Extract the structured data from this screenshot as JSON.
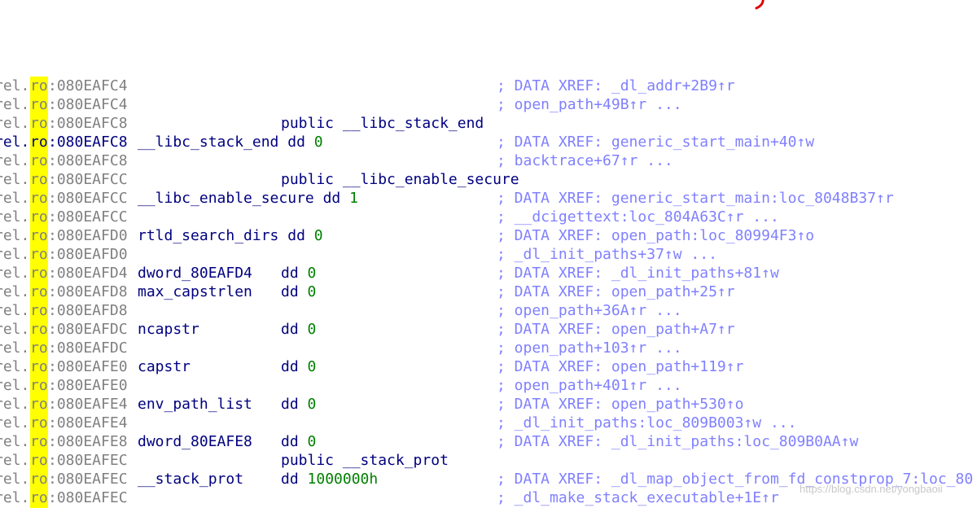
{
  "colors": {
    "address": "#808080",
    "address_current": "#000080",
    "name": "#000080",
    "number": "#008000",
    "comment": "#8080ff",
    "highlight": "#ffff00",
    "mark": "#e00000"
  },
  "segment": {
    "prefix": "rel.",
    "highlight": "ro"
  },
  "lines": [
    {
      "addr": ":080EAFC4",
      "name": "",
      "instr": "",
      "value": "",
      "comment": "; DATA XREF: _dl_addr+2B9↑r"
    },
    {
      "addr": ":080EAFC4",
      "name": "",
      "instr": "",
      "value": "",
      "comment": "; open_path+49B↑r ..."
    },
    {
      "addr": ":080EAFC8",
      "name": "",
      "instr": "public __libc_stack_end",
      "value": "",
      "comment": ""
    },
    {
      "addr": ":080EAFC8",
      "name": "__libc_stack_end dd ",
      "instr": "",
      "value": "0",
      "comment": "; DATA XREF: generic_start_main+40↑w",
      "current": true
    },
    {
      "addr": ":080EAFC8",
      "name": "",
      "instr": "",
      "value": "",
      "comment": "; backtrace+67↑r ..."
    },
    {
      "addr": ":080EAFCC",
      "name": "",
      "instr": "public __libc_enable_secure",
      "value": "",
      "comment": ""
    },
    {
      "addr": ":080EAFCC",
      "name": "__libc_enable_secure dd ",
      "instr": "",
      "value": "1",
      "comment": "; DATA XREF: generic_start_main:loc_8048B37↑r"
    },
    {
      "addr": ":080EAFCC",
      "name": "",
      "instr": "",
      "value": "",
      "comment": "; __dcigettext:loc_804A63C↑r ..."
    },
    {
      "addr": ":080EAFD0",
      "name": "rtld_search_dirs dd ",
      "instr": "",
      "value": "0",
      "comment": "; DATA XREF: open_path:loc_80994F3↑o"
    },
    {
      "addr": ":080EAFD0",
      "name": "",
      "instr": "",
      "value": "",
      "comment": "; _dl_init_paths+37↑w ..."
    },
    {
      "addr": ":080EAFD4",
      "name": "dword_80EAFD4",
      "instr": "dd ",
      "value": "0",
      "comment": "; DATA XREF: _dl_init_paths+81↑w"
    },
    {
      "addr": ":080EAFD8",
      "name": "max_capstrlen",
      "instr": "dd ",
      "value": "0",
      "comment": "; DATA XREF: open_path+25↑r"
    },
    {
      "addr": ":080EAFD8",
      "name": "",
      "instr": "",
      "value": "",
      "comment": "; open_path+36A↑r ..."
    },
    {
      "addr": ":080EAFDC",
      "name": "ncapstr",
      "instr": "dd ",
      "value": "0",
      "comment": "; DATA XREF: open_path+A7↑r"
    },
    {
      "addr": ":080EAFDC",
      "name": "",
      "instr": "",
      "value": "",
      "comment": "; open_path+103↑r ..."
    },
    {
      "addr": ":080EAFE0",
      "name": "capstr",
      "instr": "dd ",
      "value": "0",
      "comment": "; DATA XREF: open_path+119↑r"
    },
    {
      "addr": ":080EAFE0",
      "name": "",
      "instr": "",
      "value": "",
      "comment": "; open_path+401↑r ..."
    },
    {
      "addr": ":080EAFE4",
      "name": "env_path_list",
      "instr": "dd ",
      "value": "0",
      "comment": "; DATA XREF: open_path+530↑o"
    },
    {
      "addr": ":080EAFE4",
      "name": "",
      "instr": "",
      "value": "",
      "comment": "; _dl_init_paths:loc_809B003↑w ..."
    },
    {
      "addr": ":080EAFE8",
      "name": "dword_80EAFE8",
      "instr": "dd ",
      "value": "0",
      "comment": "; DATA XREF: _dl_init_paths:loc_809B0AA↑w"
    },
    {
      "addr": ":080EAFEC",
      "name": "",
      "instr": "public __stack_prot",
      "value": "",
      "comment": ""
    },
    {
      "addr": ":080EAFEC",
      "name": "__stack_prot",
      "instr": "dd ",
      "value": "1000000h",
      "comment": "; DATA XREF: _dl_map_object_from_fd_constprop_7:loc_80"
    },
    {
      "addr": ":080EAFEC",
      "name": "",
      "instr": "",
      "value": "",
      "comment": "; _dl_make_stack_executable+1E↑r"
    }
  ],
  "watermark": "https://blog.csdn.net/yongbaoii"
}
